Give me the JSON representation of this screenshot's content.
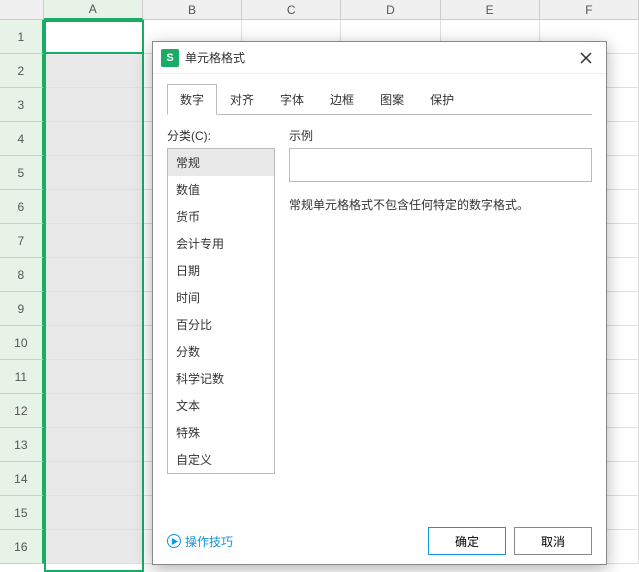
{
  "spreadsheet": {
    "columns": [
      "A",
      "B",
      "C",
      "D",
      "E",
      "F"
    ],
    "rows": [
      "1",
      "2",
      "3",
      "4",
      "5",
      "6",
      "7",
      "8",
      "9",
      "10",
      "11",
      "12",
      "13",
      "14",
      "15",
      "16"
    ],
    "selected_column_index": 0
  },
  "dialog": {
    "app_icon_text": "S",
    "title": "单元格格式",
    "tabs": [
      {
        "label": "数字",
        "active": true
      },
      {
        "label": "对齐",
        "active": false
      },
      {
        "label": "字体",
        "active": false
      },
      {
        "label": "边框",
        "active": false
      },
      {
        "label": "图案",
        "active": false
      },
      {
        "label": "保护",
        "active": false
      }
    ],
    "category_label": "分类(C):",
    "categories": [
      {
        "label": "常规",
        "selected": true
      },
      {
        "label": "数值",
        "selected": false
      },
      {
        "label": "货币",
        "selected": false
      },
      {
        "label": "会计专用",
        "selected": false
      },
      {
        "label": "日期",
        "selected": false
      },
      {
        "label": "时间",
        "selected": false
      },
      {
        "label": "百分比",
        "selected": false
      },
      {
        "label": "分数",
        "selected": false
      },
      {
        "label": "科学记数",
        "selected": false
      },
      {
        "label": "文本",
        "selected": false
      },
      {
        "label": "特殊",
        "selected": false
      },
      {
        "label": "自定义",
        "selected": false
      }
    ],
    "example_label": "示例",
    "description": "常规单元格格式不包含任何特定的数字格式。",
    "tips_label": "操作技巧",
    "ok_label": "确定",
    "cancel_label": "取消"
  }
}
